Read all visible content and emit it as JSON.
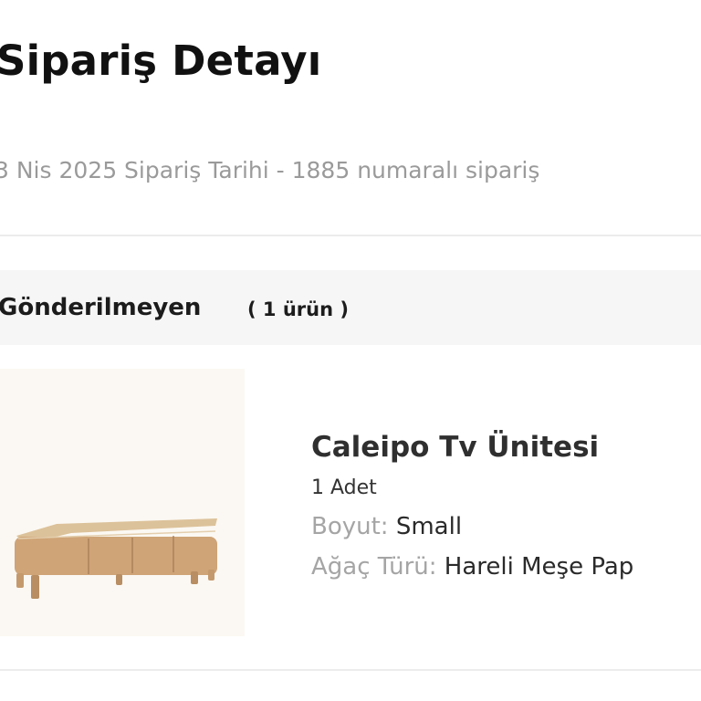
{
  "header": {
    "title": "Sipariş Detayı",
    "order_meta": "3 Nis 2025 Sipariş Tarihi - 1885 numaralı sipariş"
  },
  "section": {
    "title": "Gönderilmeyen",
    "count": "( 1 ürün )"
  },
  "product": {
    "image_icon": "tv-unit-image",
    "name": "Caleipo Tv Ünitesi",
    "quantity": "1 Adet",
    "attributes": [
      {
        "label": "Boyut:",
        "value": "Small"
      },
      {
        "label": "Ağaç Türü:",
        "value": "Hareli Meşe Pap"
      }
    ]
  }
}
